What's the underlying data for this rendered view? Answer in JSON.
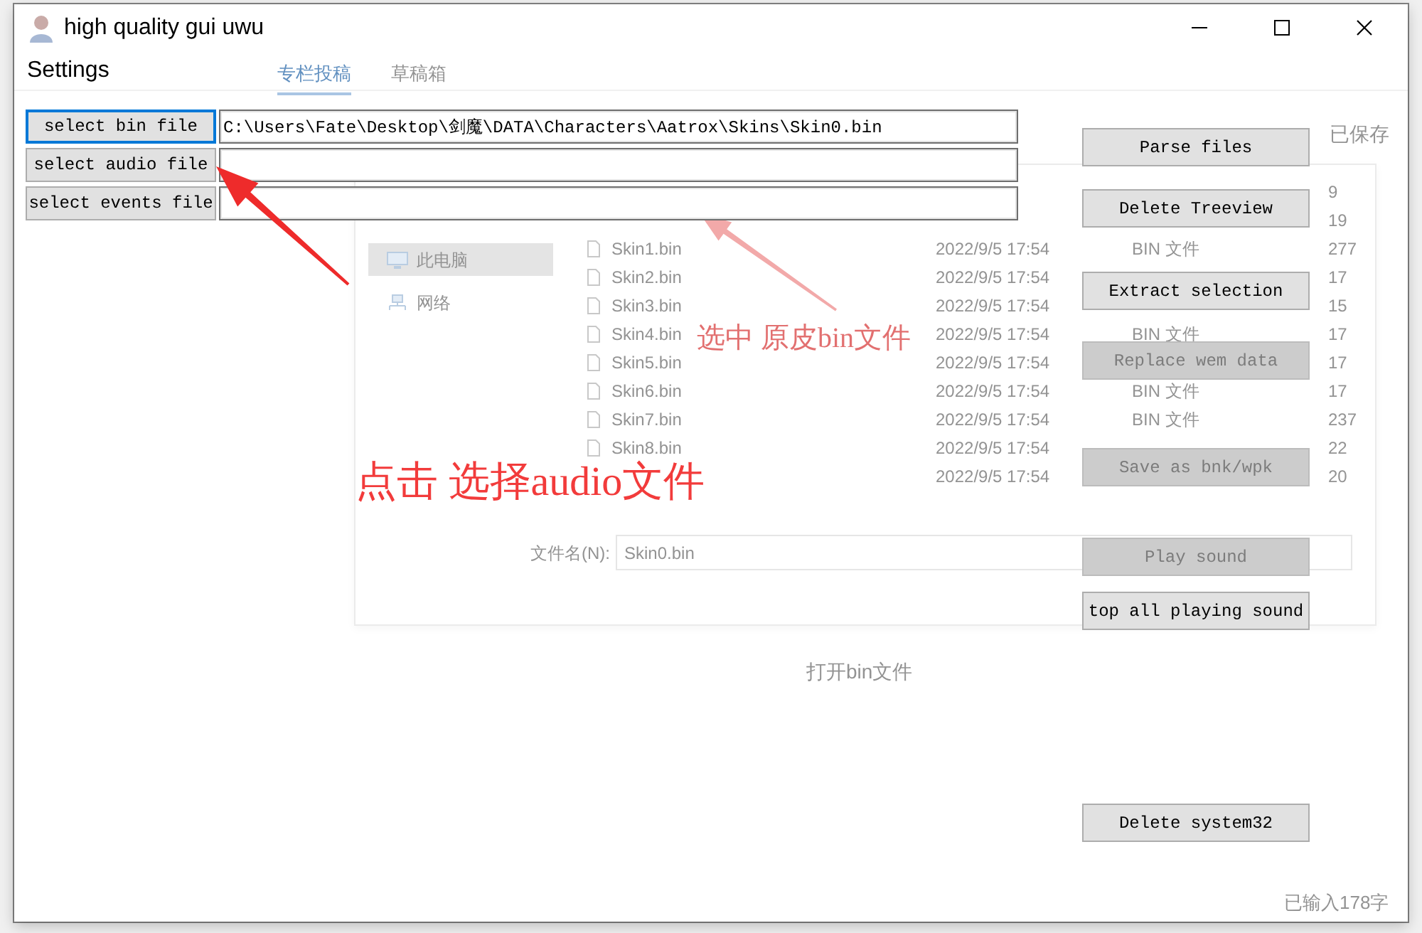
{
  "window": {
    "title": "high quality gui uwu"
  },
  "menu": [
    {
      "label": "Settings"
    }
  ],
  "file_pickers": [
    {
      "button": "select bin file",
      "focused": true,
      "path": "C:\\Users\\Fate\\Desktop\\剑魔\\DATA\\Characters\\Aatrox\\Skins\\Skin0.bin"
    },
    {
      "button": "select audio file",
      "focused": false
    },
    {
      "button": "select events file",
      "focused": false
    }
  ],
  "actions": [
    {
      "label": "Parse files",
      "disabled": false
    },
    {
      "label": "Delete Treeview",
      "disabled": false
    },
    {
      "label": "Extract selection",
      "disabled": false
    },
    {
      "label": "Replace wem data",
      "disabled": true
    },
    {
      "label": "Save as bnk/wpk",
      "disabled": true
    },
    {
      "label": "Play sound",
      "disabled": true
    },
    {
      "label": "top all playing sound",
      "disabled": false
    },
    {
      "label": "Delete system32",
      "disabled": false
    }
  ],
  "annotation": {
    "text": "点击 选择audio文件"
  },
  "background": {
    "tabs": [
      {
        "label": "专栏投稿",
        "selected": true
      },
      {
        "label": "草稿箱",
        "selected": false
      }
    ],
    "save_status": "已保存",
    "file_dialog": {
      "places": [
        {
          "label": "此电脑",
          "selected": true
        },
        {
          "label": "网络",
          "selected": false
        }
      ],
      "files": [
        {
          "size": "9"
        },
        {
          "size": "19"
        },
        {
          "name": "Skin1.bin",
          "date": "2022/9/5 17:54",
          "type": "BIN 文件",
          "size": "277"
        },
        {
          "name": "Skin2.bin",
          "date": "2022/9/5 17:54",
          "size": "17"
        },
        {
          "name": "Skin3.bin",
          "date": "2022/9/5 17:54",
          "size": "15"
        },
        {
          "name": "Skin4.bin",
          "date": "2022/9/5 17:54",
          "type": "BIN 文件",
          "size": "17"
        },
        {
          "name": "Skin5.bin",
          "date": "2022/9/5 17:54",
          "size": "17"
        },
        {
          "name": "Skin6.bin",
          "date": "2022/9/5 17:54",
          "type": "BIN 文件",
          "size": "17"
        },
        {
          "name": "Skin7.bin",
          "date": "2022/9/5 17:54",
          "type": "BIN 文件",
          "size": "237"
        },
        {
          "name": "Skin8.bin",
          "date": "2022/9/5 17:54",
          "size": "22"
        },
        {
          "date": "2022/9/5 17:54",
          "size": "20"
        }
      ],
      "file_name_label": "文件名(N):",
      "file_name": "Skin0.bin"
    },
    "callout": "选中 原皮bin文件",
    "caption": "打开bin文件",
    "word_count": "已输入178字"
  }
}
